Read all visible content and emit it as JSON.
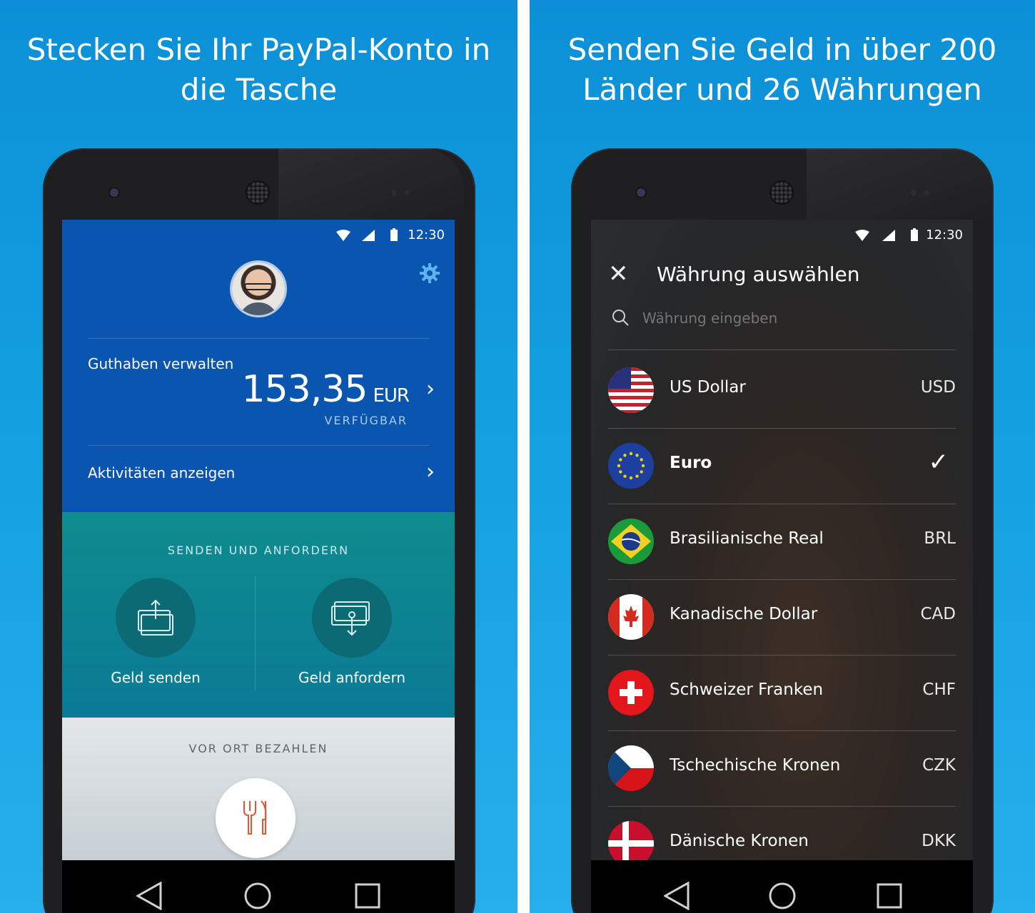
{
  "left": {
    "headline": "Stecken Sie Ihr PayPal-Konto in die Tasche",
    "status": {
      "time": "12:30"
    },
    "profile": {
      "settings_icon": "gear-icon"
    },
    "balance": {
      "label": "Guthaben verwalten",
      "amount": "153,35",
      "currency": "EUR",
      "sublabel": "VERFÜGBAR"
    },
    "activity": {
      "label": "Aktivitäten anzeigen"
    },
    "send_section": {
      "title": "SENDEN UND ANFORDERN",
      "send_label": "Geld senden",
      "request_label": "Geld anfordern"
    },
    "pay_section": {
      "title": "VOR ORT BEZAHLEN"
    },
    "colors": {
      "profile_bg": "#0a55b0",
      "send_bg": "#0f8c8e",
      "accent_orange": "#e8542b"
    }
  },
  "right": {
    "headline": "Senden Sie Geld in über 200 Länder und 26 Währungen",
    "status": {
      "time": "12:30"
    },
    "title": "Währung auswählen",
    "search_placeholder": "Währung eingeben",
    "currencies": [
      {
        "name": "US Dollar",
        "code": "USD",
        "flag": "us-flag-icon",
        "selected": false
      },
      {
        "name": "Euro",
        "code": "",
        "flag": "eu-flag-icon",
        "selected": true
      },
      {
        "name": "Brasilianische Real",
        "code": "BRL",
        "flag": "br-flag-icon",
        "selected": false
      },
      {
        "name": "Kanadische Dollar",
        "code": "CAD",
        "flag": "ca-flag-icon",
        "selected": false
      },
      {
        "name": "Schweizer Franken",
        "code": "CHF",
        "flag": "ch-flag-icon",
        "selected": false
      },
      {
        "name": "Tschechische Kronen",
        "code": "CZK",
        "flag": "cz-flag-icon",
        "selected": false
      },
      {
        "name": "Dänische Kronen",
        "code": "DKK",
        "flag": "dk-flag-icon",
        "selected": false
      }
    ]
  },
  "background_color": "#139fe0"
}
